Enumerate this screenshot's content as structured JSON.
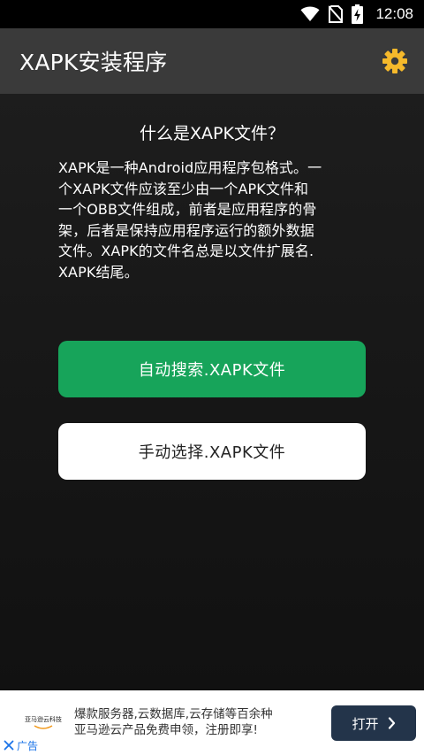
{
  "status_bar": {
    "time": "12:08",
    "icons": [
      "wifi-icon",
      "no-sim-icon",
      "battery-charging-icon"
    ]
  },
  "app_bar": {
    "title": "XAPK安装程序",
    "settings_icon": "gear-icon",
    "settings_color": "#f5b92b"
  },
  "content": {
    "question": "什么是XAPK文件？",
    "description_lines": [
      "XAPK是一种Android应用程序包格式。一",
      "个XAPK文件应该至少由一个APK文件和",
      "一个OBB文件组成，前者是应用程序的骨",
      "架，后者是保持应用程序运行的额外数据",
      "文件。XAPK的文件名总是以文件扩展名.",
      "XAPK结尾。"
    ]
  },
  "buttons": {
    "auto_search": "自动搜索.XAPK文件",
    "manual_select": "手动选择.XAPK文件",
    "accent_color": "#17a45a"
  },
  "ad": {
    "logo_text": "亚马逊云科技",
    "line1": "爆款服务器,云数据库,云存储等百余种",
    "line2": "亚马逊云产品免费申领，注册即享!",
    "open_label": "打开",
    "close_label": "广告",
    "button_color": "#23344a"
  }
}
